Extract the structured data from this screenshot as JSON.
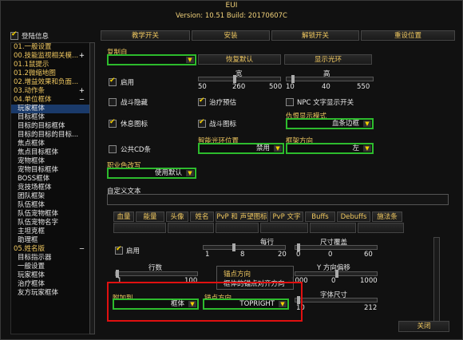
{
  "title": "EUI",
  "version_text": "Version: 10.51 Build: 20170607C",
  "login_info": "登陆信息",
  "top_buttons": [
    "教学开关",
    "安装",
    "解锁开关",
    "重设位置"
  ],
  "sidebar": [
    {
      "label": "01.一般设置",
      "kind": "cat"
    },
    {
      "label": "00.技能监视相关模...",
      "kind": "cat",
      "pm": "+"
    },
    {
      "label": "01.1鼠提示",
      "kind": "cat"
    },
    {
      "label": "01.2微缩地图",
      "kind": "cat"
    },
    {
      "label": "02.增益效果和负面...",
      "kind": "cat"
    },
    {
      "label": "03.动作条",
      "kind": "cat",
      "pm": "+"
    },
    {
      "label": "04.单位框体",
      "kind": "cat",
      "pm": "−"
    },
    {
      "label": "玩家框体",
      "kind": "sub",
      "selected": true
    },
    {
      "label": "目标框体",
      "kind": "sub"
    },
    {
      "label": "目标的目标框体",
      "kind": "sub"
    },
    {
      "label": "目标的目标的目标...",
      "kind": "sub"
    },
    {
      "label": "焦点框体",
      "kind": "sub"
    },
    {
      "label": "焦点目标框体",
      "kind": "sub"
    },
    {
      "label": "宠物框体",
      "kind": "sub"
    },
    {
      "label": "宠物目标框体",
      "kind": "sub"
    },
    {
      "label": "BOSS框体",
      "kind": "sub"
    },
    {
      "label": "竞技场框体",
      "kind": "sub"
    },
    {
      "label": "团队框架",
      "kind": "sub"
    },
    {
      "label": "队伍框体",
      "kind": "sub"
    },
    {
      "label": "队伍宠物框体",
      "kind": "sub"
    },
    {
      "label": "队伍宠物名字",
      "kind": "sub"
    },
    {
      "label": "主坦克框",
      "kind": "sub"
    },
    {
      "label": "助理框",
      "kind": "sub"
    },
    {
      "label": "05.姓名版",
      "kind": "cat",
      "pm": "−"
    },
    {
      "label": "目标指示器",
      "kind": "sub"
    },
    {
      "label": "一般设置",
      "kind": "sub"
    },
    {
      "label": "玩家框体",
      "kind": "sub"
    },
    {
      "label": "治疗框体",
      "kind": "sub"
    },
    {
      "label": "友方玩家框体",
      "kind": "sub"
    }
  ],
  "main": {
    "copy_from": {
      "label": "复制自",
      "value": ""
    },
    "restore_default": "恢复默认",
    "show_halo": "显示光环",
    "enable": "启用",
    "width": {
      "label": "宽",
      "min": "50",
      "value": "260",
      "max": "500"
    },
    "height": {
      "label": "高",
      "min": "10",
      "value": "40",
      "max": "550"
    },
    "combat_hide": "战斗隐藏",
    "heal_predict": "治疗预估",
    "npc_text_toggle": "NPC 文字显示开关",
    "rest_icon": "休息图标",
    "combat_icon": "战斗图标",
    "threat_mode": {
      "label": "仇恨显示模式",
      "value": "血条边框"
    },
    "public_cd": "公共CD条",
    "smart_aura": {
      "label": "智能光环位置",
      "value": "禁用"
    },
    "frame_dir": {
      "label": "框架方向",
      "value": "左"
    },
    "class_color": {
      "label": "职业色改写",
      "value": "使用默认"
    },
    "custom_text": "自定义文本",
    "tabs_row1": [
      "血量",
      "能量",
      "头像",
      "姓名",
      "PvP 和 声望图标",
      "PvP 文字",
      "Buffs",
      "Debuffs",
      "施法条"
    ],
    "tabs_row2": [
      "平衡计时条",
      "职业条",
      "光环条",
      "护盾监视",
      "信息面板",
      "团队图标"
    ],
    "per_row": {
      "label": "每行",
      "min": "1",
      "value": "8",
      "max": "20"
    },
    "size_overlap": {
      "label": "尺寸覆盖",
      "min": "0",
      "value": "0",
      "max": "60"
    },
    "enable2": "启用",
    "rows": {
      "label": "行数",
      "min": "1",
      "max": "100"
    },
    "y_offset": {
      "label": "Y 方向偏移",
      "min": "-1000",
      "value": "0",
      "max": "1000"
    },
    "anchor_overlay_label": "锚点方向",
    "anchor_overlay_desc": "框体的锚点对齐方向",
    "attach_to": {
      "label": "附加到",
      "value": "框体"
    },
    "anchor_dir": {
      "label": "锚点方向",
      "value": "TOPRIGHT"
    },
    "font_size": {
      "label": "字体尺寸",
      "min": "10",
      "max": "212"
    },
    "close": "关闭"
  },
  "colors": {
    "accent_gold": "#f0c860",
    "highlight_green": "#2dbb2d",
    "callout_red": "#e01010",
    "selected_blue": "#1a3a6a"
  }
}
